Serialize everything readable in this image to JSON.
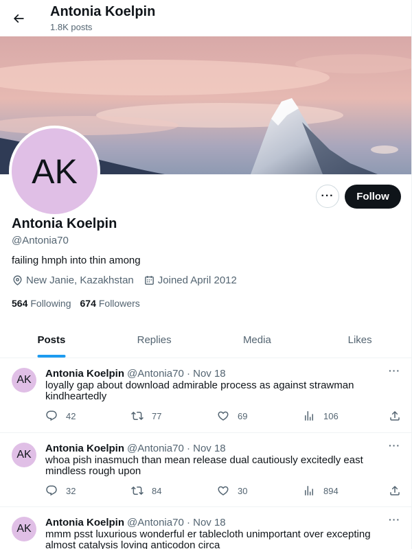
{
  "header": {
    "title": "Antonia Koelpin",
    "posts_count": "1.8K posts"
  },
  "profile": {
    "avatar_initials": "AK",
    "name": "Antonia Koelpin",
    "handle": "@Antonia70",
    "bio": "failing hmph into thin among",
    "location": "New Janie, Kazakhstan",
    "joined": "Joined April 2012",
    "following_count": "564",
    "following_label": "Following",
    "followers_count": "674",
    "followers_label": "Followers",
    "follow_label": "Follow",
    "more_label": "···"
  },
  "tabs": [
    {
      "label": "Posts",
      "active": true
    },
    {
      "label": "Replies",
      "active": false
    },
    {
      "label": "Media",
      "active": false
    },
    {
      "label": "Likes",
      "active": false
    }
  ],
  "posts": [
    {
      "avatar": "AK",
      "name": "Antonia Koelpin",
      "meta": "@Antonia70 · Nov 18",
      "text": "loyally gap about download admirable process as against strawman kindheartedly",
      "replies": "42",
      "reposts": "77",
      "likes": "69",
      "views": "106",
      "more": "···"
    },
    {
      "avatar": "AK",
      "name": "Antonia Koelpin",
      "meta": "@Antonia70 · Nov 18",
      "text": "whoa pish inasmuch than mean release dual cautiously excitedly east mindless rough upon",
      "replies": "32",
      "reposts": "84",
      "likes": "30",
      "views": "894",
      "more": "···"
    },
    {
      "avatar": "AK",
      "name": "Antonia Koelpin",
      "meta": "@Antonia70 · Nov 18",
      "text": "mmm psst luxurious wonderful er tablecloth unimportant over excepting almost catalysis loving anticodon circa",
      "replies": "",
      "reposts": "",
      "likes": "",
      "views": "",
      "more": "···"
    }
  ],
  "colors": {
    "accent": "#1d9bf0",
    "avatar_bg": "#e0bfe6",
    "text": "#0f1419",
    "muted": "#536471"
  }
}
